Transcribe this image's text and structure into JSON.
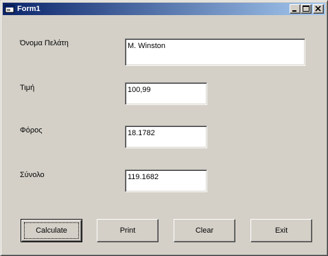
{
  "window": {
    "title": "Form1",
    "minimize_label": "_",
    "maximize_label": "□",
    "close_label": "×"
  },
  "fields": {
    "customer_name": {
      "label": "Όνομα Πελάτη",
      "value": "M. Winston"
    },
    "price": {
      "label": "Τιμή",
      "value": "100,99"
    },
    "tax": {
      "label": "Φόρος",
      "value": "18.1782"
    },
    "total": {
      "label": "Σύνολο",
      "value": "119.1682"
    }
  },
  "buttons": {
    "calculate": "Calculate",
    "print": "Print",
    "clear": "Clear",
    "exit": "Exit"
  }
}
